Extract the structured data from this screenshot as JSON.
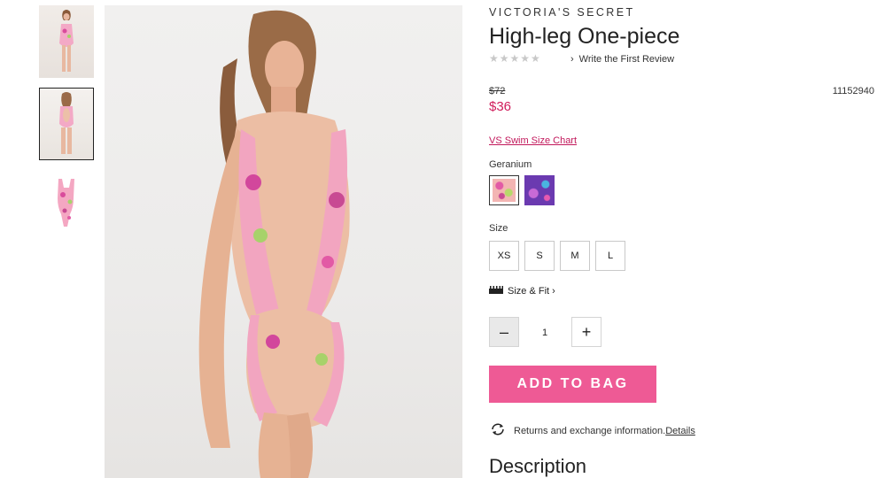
{
  "brand": "VICTORIA'S SECRET",
  "product": {
    "title": "High-leg One-piece",
    "rating_stars": "★★★★★",
    "review_link": "Write the First Review",
    "original_price": "$72",
    "sale_price": "$36",
    "sku": "11152940"
  },
  "links": {
    "size_chart": "VS Swim Size Chart",
    "size_fit": "Size & Fit"
  },
  "color": {
    "selected_name": "Geranium",
    "swatches": [
      "geranium-floral",
      "purple-floral"
    ]
  },
  "size": {
    "label": "Size",
    "options": [
      "XS",
      "S",
      "M",
      "L"
    ]
  },
  "quantity": {
    "minus": "–",
    "value": "1",
    "plus": "+"
  },
  "cta": {
    "add_to_bag": "ADD TO BAG"
  },
  "returns": {
    "text": "Returns and exchange information.",
    "link": "Details"
  },
  "description_heading": "Description",
  "colors": {
    "accent_pink": "#ee5a95",
    "sale_red": "#d01d5b",
    "link_pink": "#c2185b"
  },
  "icons": {
    "review_chevron": "chevron-right-icon",
    "fit": "ruler-icon",
    "returns": "refresh-icon"
  }
}
